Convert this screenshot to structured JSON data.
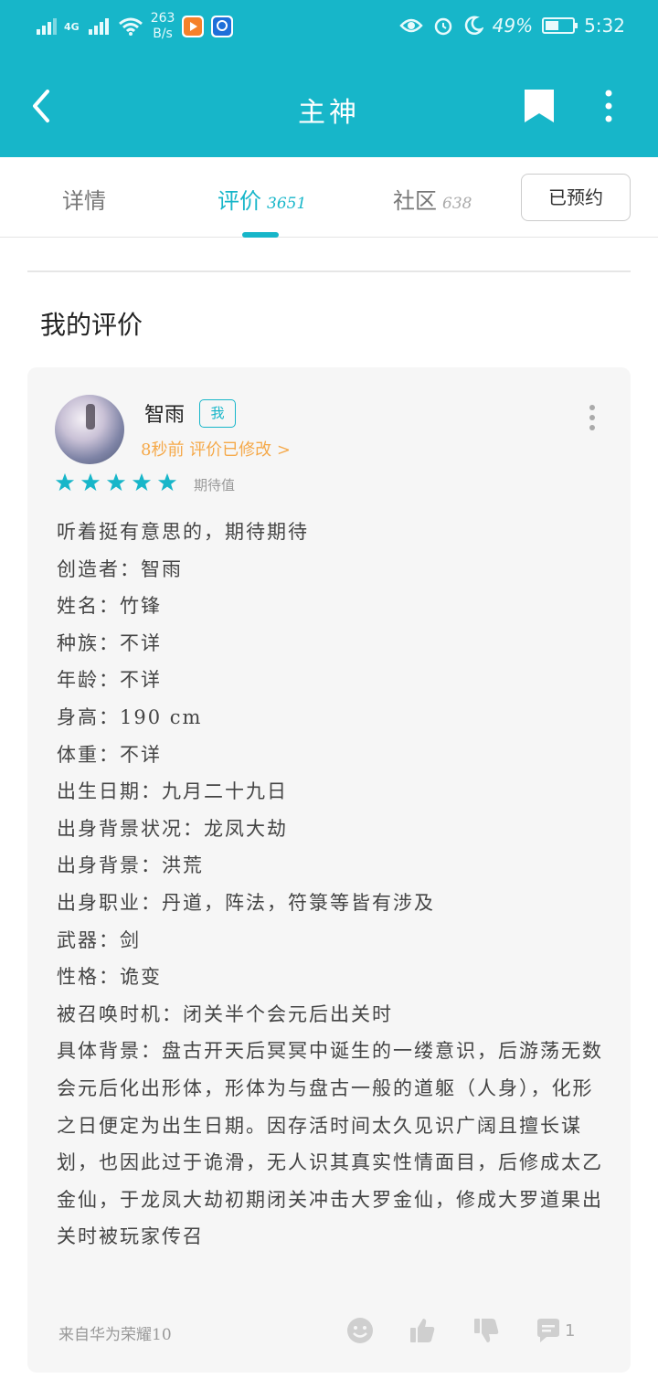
{
  "status_bar": {
    "network": "4G",
    "speed_value": "263",
    "speed_unit": "B/s",
    "battery": "49%",
    "time": "5:32",
    "icons": [
      "signal-icon",
      "wifi-icon",
      "eye-icon",
      "alarm-icon",
      "moon-icon",
      "battery-icon"
    ]
  },
  "app_bar": {
    "title": "主神",
    "icons": [
      "back-icon",
      "bookmark-icon",
      "more-icon"
    ]
  },
  "tabs": [
    {
      "label": "详情",
      "count": ""
    },
    {
      "label": "评价",
      "count": "3651"
    },
    {
      "label": "社区",
      "count": "638"
    }
  ],
  "reserve_button": "已预约",
  "section_title": "我的评价",
  "review": {
    "username": "智雨",
    "badge": "我",
    "meta": "8秒前 评价已修改 >",
    "rating": 5,
    "rating_label": "期待值",
    "lines": [
      "听着挺有意思的，期待期待",
      "创造者：智雨",
      "姓名：竹锋",
      "种族：不详",
      "年龄：不详",
      "身高：190 cm",
      "体重：不详",
      "出生日期：九月二十九日",
      "出身背景状况：龙凤大劫",
      "出身背景：洪荒",
      "出身职业：丹道，阵法，符箓等皆有涉及",
      "武器：剑",
      "性格：诡变",
      "被召唤时机：闭关半个会元后出关时",
      "具体背景：盘古开天后冥冥中诞生的一缕意识，后游荡无数会元后化出形体，形体为与盘古一般的道躯（人身），化形之日便定为出生日期。因存活时间太久见识广阔且擅长谋划，也因此过于诡滑，无人识其真实性情面目，后修成太乙金仙，于龙凤大劫初期闭关冲击大罗金仙，修成大罗道果出关时被玩家传召"
    ],
    "source": "来自华为荣耀10",
    "comment_count": "1",
    "colors": {
      "accent": "#17b6c9",
      "meta": "#f5a94a",
      "card": "#f6f6f6"
    }
  }
}
